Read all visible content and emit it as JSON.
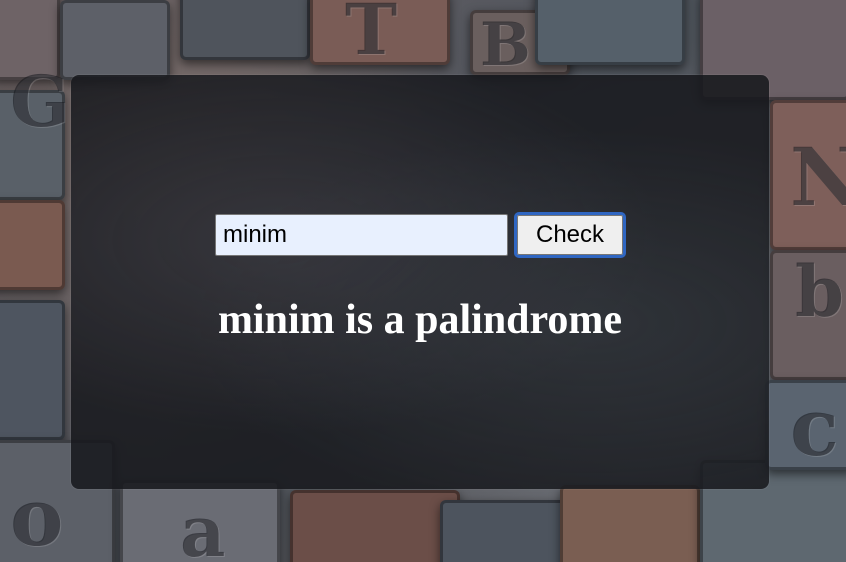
{
  "form": {
    "input_value": "minim",
    "check_label": "Check"
  },
  "result": {
    "message": "minim is a palindrome"
  },
  "colors": {
    "panel": "#18191e",
    "input_bg": "#e8f0fe",
    "button_focus": "#2f66c2",
    "result_text": "#ffffff"
  }
}
